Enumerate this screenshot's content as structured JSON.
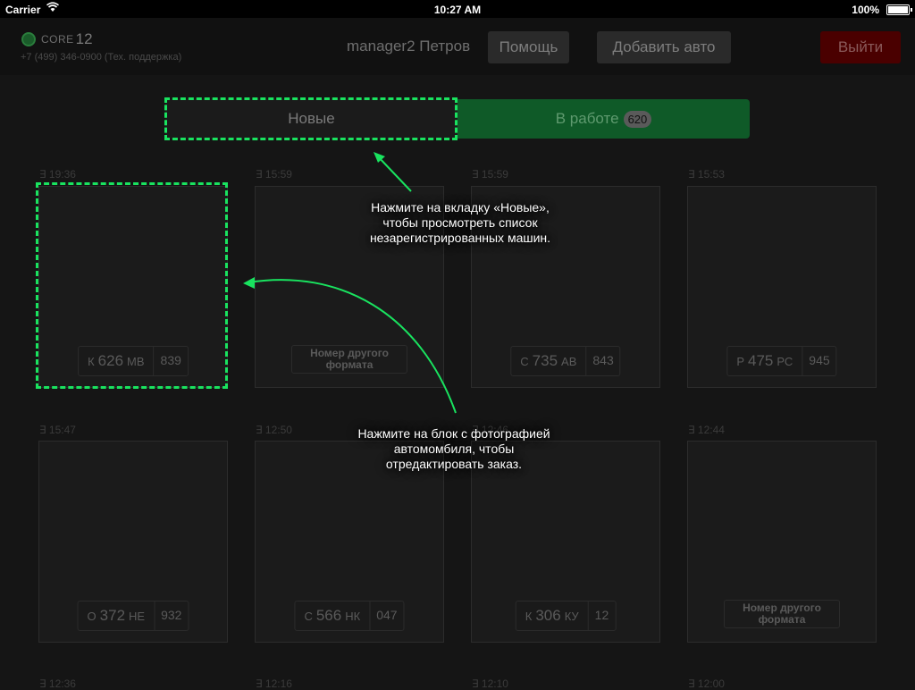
{
  "status": {
    "carrier": "Carrier",
    "time": "10:27 AM",
    "battery": "100%"
  },
  "header": {
    "logo_core": "CORE",
    "logo_num": "12",
    "support": "+7 (499) 346-0900 (Тех. поддержка)",
    "username": "manager2 Петров",
    "help": "Помощь",
    "add": "Добавить авто",
    "exit": "Выйти"
  },
  "tabs": {
    "new": "Новые",
    "work": "В работе",
    "work_count": "620"
  },
  "hints": {
    "tab": "Нажмите на вкладку «Новые»,\nчтобы просмотреть список\nнезарегистрированных машин.",
    "card": "Нажмите на блок с фотографией\nавтомомбиля, чтобы\nотредактировать заказ."
  },
  "cards": [
    {
      "time": "19:36",
      "letter1": "К",
      "number": "626",
      "letters2": "МВ",
      "region": "839"
    },
    {
      "time": "15:59",
      "other": "Номер другого формата"
    },
    {
      "time": "15:59",
      "letter1": "С",
      "number": "735",
      "letters2": "АВ",
      "region": "843"
    },
    {
      "time": "15:53",
      "letter1": "Р",
      "number": "475",
      "letters2": "РС",
      "region": "945"
    },
    {
      "time": "15:47",
      "letter1": "О",
      "number": "372",
      "letters2": "НЕ",
      "region": "932"
    },
    {
      "time": "12:50",
      "letter1": "С",
      "number": "566",
      "letters2": "НК",
      "region": "047"
    },
    {
      "time": "12:46",
      "letter1": "К",
      "number": "306",
      "letters2": "КУ",
      "region": "12"
    },
    {
      "time": "12:44",
      "other": "Номер другого формата"
    }
  ],
  "bottom_times": [
    "12:36",
    "12:16",
    "12:10",
    "12:00"
  ]
}
